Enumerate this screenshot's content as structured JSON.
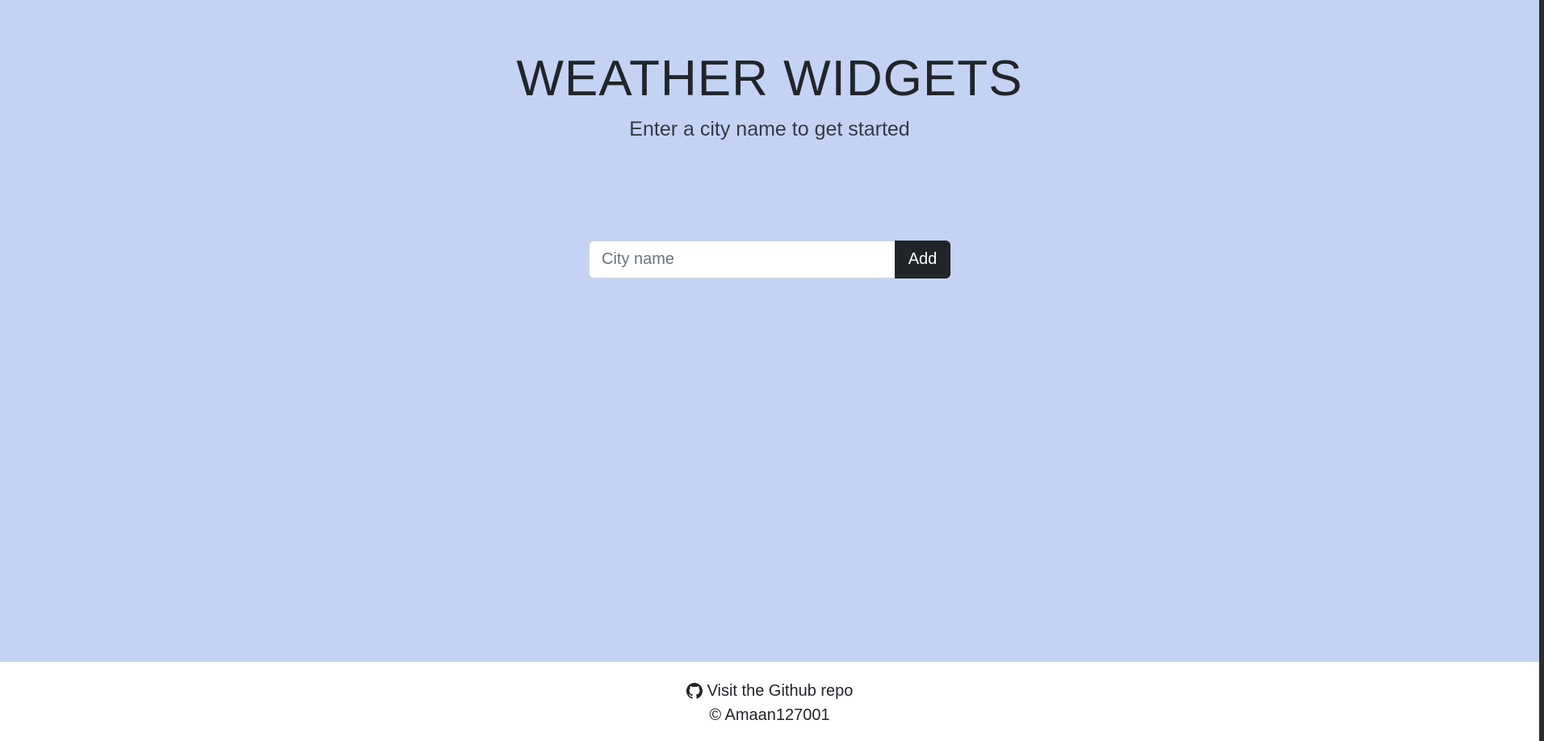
{
  "header": {
    "title": "WEATHER WIDGETS",
    "subtitle": "Enter a city name to get started"
  },
  "search": {
    "placeholder": "City name",
    "value": "",
    "add_label": "Add"
  },
  "footer": {
    "repo_link_label": "Visit the Github repo",
    "repo_icon": "github-icon",
    "copyright": "© Amaan127001"
  },
  "colors": {
    "main_background": "#c4d3f4",
    "footer_background": "#ffffff",
    "button_background": "#212529",
    "text": "#212529"
  }
}
